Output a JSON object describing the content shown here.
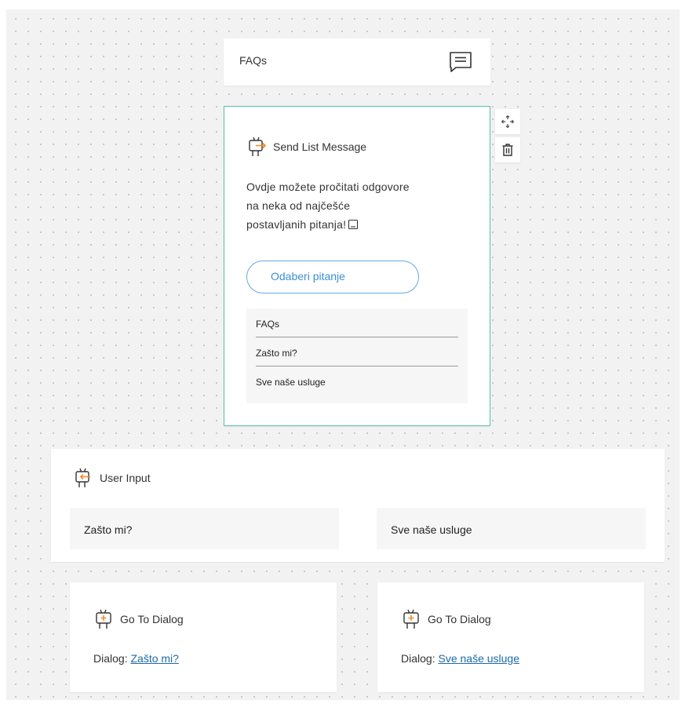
{
  "colors": {
    "accent": "#55c4ad",
    "link": "#1d6aa8",
    "button": "#3c8fd8",
    "icon_orange": "#f28c28"
  },
  "faqs_header": {
    "title": "FAQs",
    "icon": "chat-icon"
  },
  "send_list_message": {
    "title": "Send List Message",
    "message": "Ovdje možete pročitati odgovore na neka od najčešće postavljanih pitanja!",
    "button_label": "Odaberi pitanje",
    "list_items": [
      "FAQs",
      "Zašto mi?",
      "Sve naše usluge"
    ]
  },
  "tools": {
    "move_icon": "move-icon",
    "delete_icon": "trash-icon"
  },
  "user_input": {
    "title": "User Input",
    "options": [
      "Zašto mi?",
      "Sve naše usluge"
    ]
  },
  "go_to_dialogs": [
    {
      "title": "Go To Dialog",
      "label": "Dialog:",
      "target": "Zašto mi?"
    },
    {
      "title": "Go To Dialog",
      "label": "Dialog:",
      "target": "Sve naše usluge"
    }
  ]
}
